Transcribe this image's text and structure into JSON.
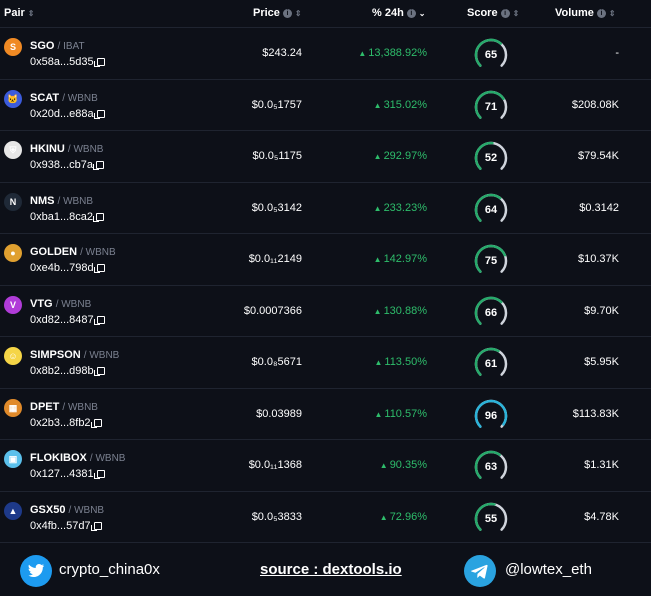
{
  "header": {
    "pair": "Pair",
    "price": "Price",
    "change": "% 24h",
    "score": "Score",
    "volume": "Volume"
  },
  "rows": [
    {
      "symbol": "SGO",
      "base": "/ IBAT",
      "address": "0x58a...5d35",
      "price": "$243.24",
      "change": "13,388.92%",
      "score": 65,
      "volume": "-",
      "logo_color": "#f08a24",
      "logo_glyph": "S"
    },
    {
      "symbol": "SCAT",
      "base": "/ WBNB",
      "address": "0x20d...e88a",
      "price": "$0.0₅1757",
      "change": "315.02%",
      "score": 71,
      "volume": "$208.08K",
      "logo_color": "#3b5bdb",
      "logo_glyph": "🐱"
    },
    {
      "symbol": "HKINU",
      "base": "/ WBNB",
      "address": "0x938...cb7a",
      "price": "$0.0₅1175",
      "change": "292.97%",
      "score": 52,
      "volume": "$79.54K",
      "logo_color": "#e6e6e6",
      "logo_glyph": "⛨"
    },
    {
      "symbol": "NMS",
      "base": "/ WBNB",
      "address": "0xba1...8ca2",
      "price": "$0.0₅3142",
      "change": "233.23%",
      "score": 64,
      "volume": "$0.3142",
      "logo_color": "#1f2937",
      "logo_glyph": "N"
    },
    {
      "symbol": "GOLDEN",
      "base": "/ WBNB",
      "address": "0xe4b...798d",
      "price": "$0.0₁₁2149",
      "change": "142.97%",
      "score": 75,
      "volume": "$10.37K",
      "logo_color": "#e0a030",
      "logo_glyph": "●"
    },
    {
      "symbol": "VTG",
      "base": "/ WBNB",
      "address": "0xd82...8487",
      "price": "$0.0007366",
      "change": "130.88%",
      "score": 66,
      "volume": "$9.70K",
      "logo_color": "#b03cd8",
      "logo_glyph": "V"
    },
    {
      "symbol": "SIMPSON",
      "base": "/ WBNB",
      "address": "0x8b2...d98b",
      "price": "$0.0₈5671",
      "change": "113.50%",
      "score": 61,
      "volume": "$5.95K",
      "logo_color": "#f5d547",
      "logo_glyph": "☺"
    },
    {
      "symbol": "DPET",
      "base": "/ WBNB",
      "address": "0x2b3...8fb2",
      "price": "$0.03989",
      "change": "110.57%",
      "score": 96,
      "volume": "$113.83K",
      "logo_color": "#e08a2a",
      "logo_glyph": "▦"
    },
    {
      "symbol": "FLOKIBOX",
      "base": "/ WBNB",
      "address": "0x127...4381",
      "price": "$0.0₁₁1368",
      "change": "90.35%",
      "score": 63,
      "volume": "$1.31K",
      "logo_color": "#5bc0eb",
      "logo_glyph": "▣"
    },
    {
      "symbol": "GSX50",
      "base": "/ WBNB",
      "address": "0x4fb...57d7",
      "price": "$0.0₅3833",
      "change": "72.96%",
      "score": 55,
      "volume": "$4.78K",
      "logo_color": "#1e3a8a",
      "logo_glyph": "▲"
    }
  ],
  "footer": {
    "twitter": "crypto_china0x",
    "source": "source : dextools.io",
    "telegram": "@lowtex_eth"
  },
  "colors": {
    "background": "#0d1018",
    "positive": "#2ebd6b",
    "score_green": "#27a96b",
    "score_blue": "#2bb3d9",
    "score_track": "#cfd4dc",
    "twitter": "#1d9bf0",
    "telegram": "#2aa3e0"
  }
}
